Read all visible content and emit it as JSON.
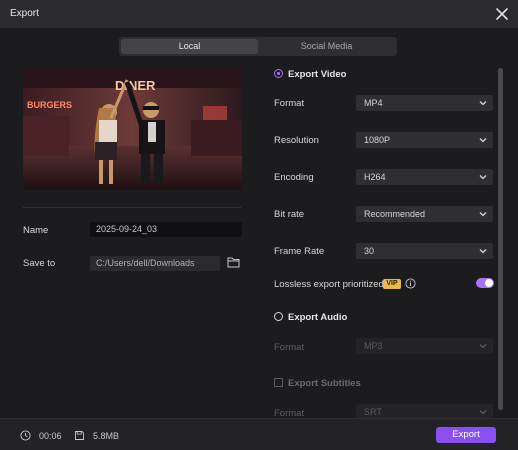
{
  "window": {
    "title": "Export"
  },
  "tabs": [
    {
      "label": "Local",
      "active": true
    },
    {
      "label": "Social Media",
      "active": false
    }
  ],
  "preview": {
    "sign_top": "DINER",
    "sign_left": "BURGERS"
  },
  "left": {
    "name_label": "Name",
    "name_value": "2025-09-24_03",
    "save_label": "Save to",
    "save_value": "C:/Users/dell/Downloads"
  },
  "video": {
    "section_label": "Export Video",
    "rows": [
      {
        "label": "Format",
        "value": "MP4"
      },
      {
        "label": "Resolution",
        "value": "1080P"
      },
      {
        "label": "Encoding",
        "value": "H264"
      },
      {
        "label": "Bit rate",
        "value": "Recommended"
      },
      {
        "label": "Frame Rate",
        "value": "30"
      }
    ],
    "lossless_label": "Lossless export prioritized",
    "vip_badge": "VIP",
    "lossless_enabled": true
  },
  "audio": {
    "section_label": "Export Audio",
    "format_label": "Format",
    "format_value": "MP3"
  },
  "subtitles": {
    "section_label": "Export Subtitles",
    "format_label": "Format",
    "format_value": "SRT"
  },
  "footer": {
    "duration": "00:06",
    "size": "5.8MB",
    "export_label": "Export"
  },
  "colors": {
    "accent": "#a874f5",
    "export_button": "#8a4ff0",
    "vip": "#e9b84a",
    "background": "#1c1c1f"
  }
}
